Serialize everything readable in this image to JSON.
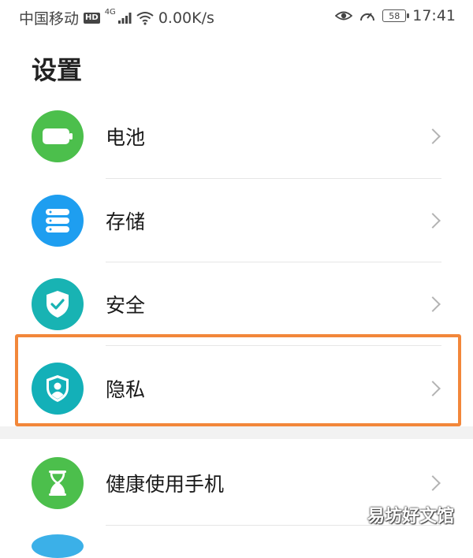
{
  "status_bar": {
    "carrier": "中国移动",
    "hd_badge": "HD",
    "network_type": "4G",
    "net_speed": "0.00K/s",
    "battery_level": "58",
    "time": "17:41",
    "icons": [
      "signal-icon",
      "wifi-icon",
      "eye-comfort-icon",
      "speed-gauge-icon",
      "battery-icon"
    ]
  },
  "page": {
    "title": "设置"
  },
  "settings_items": [
    {
      "label": "电池",
      "icon": "battery-icon",
      "color": "#4cbf4c"
    },
    {
      "label": "存储",
      "icon": "storage-icon",
      "color": "#1e9ef0"
    },
    {
      "label": "安全",
      "icon": "shield-check-icon",
      "color": "#18b3b3"
    },
    {
      "label": "隐私",
      "icon": "privacy-shield-user-icon",
      "color": "#13b0b8",
      "highlighted": true
    },
    {
      "label": "健康使用手机",
      "icon": "hourglass-icon",
      "color": "#4cbf4c"
    }
  ],
  "highlight_color": "#f2873a",
  "watermark": "易坊好文馆"
}
